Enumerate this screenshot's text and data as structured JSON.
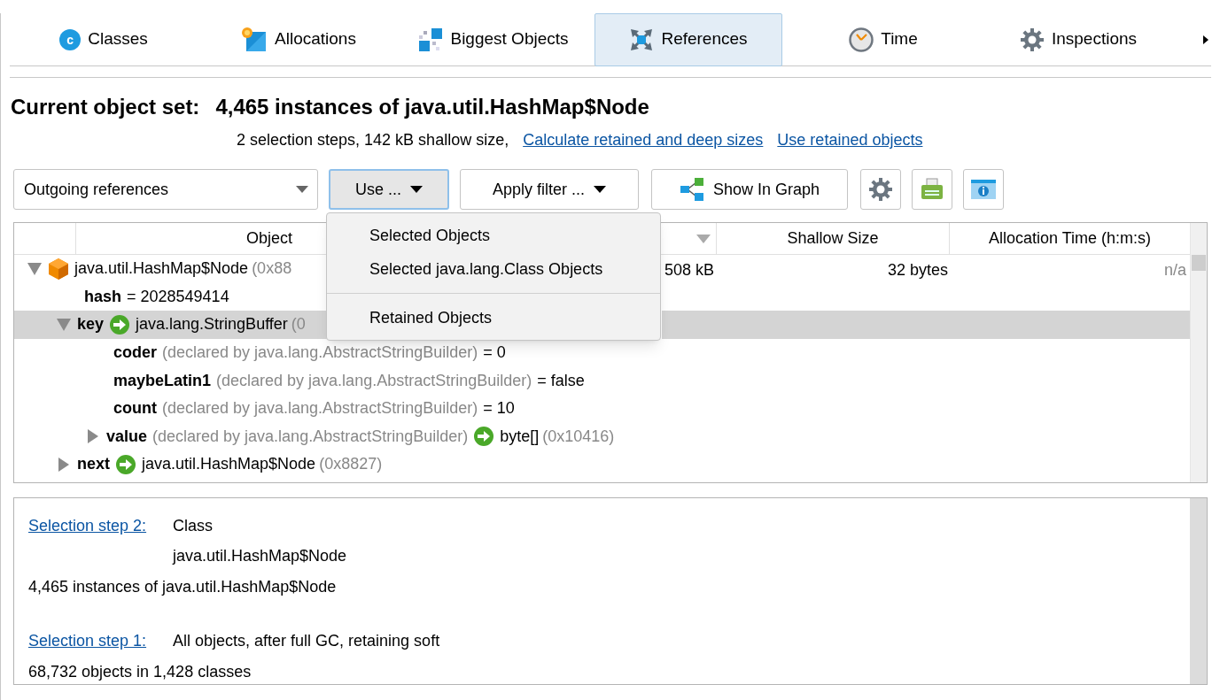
{
  "tabs": [
    {
      "label": "Classes",
      "badge": "c",
      "selected": false
    },
    {
      "label": "Allocations",
      "selected": false
    },
    {
      "label": "Biggest Objects",
      "selected": false
    },
    {
      "label": "References",
      "selected": true
    },
    {
      "label": "Time",
      "selected": false
    },
    {
      "label": "Inspections",
      "selected": false
    }
  ],
  "header": {
    "label": "Current object set:",
    "value": "4,465 instances of java.util.HashMap$Node",
    "summary": "2 selection steps, 142 kB shallow size,",
    "links": [
      "Calculate retained and deep sizes",
      "Use retained objects"
    ]
  },
  "toolbar": {
    "view_select": "Outgoing references",
    "use_button": {
      "label": "Use ...",
      "open": true
    },
    "filter_button": "Apply filter ...",
    "graph_button": "Show In Graph"
  },
  "use_menu": [
    {
      "kind": "item",
      "label": "Selected Objects"
    },
    {
      "kind": "item",
      "label": "Selected java.lang.Class Objects"
    },
    {
      "kind": "separator"
    },
    {
      "kind": "item",
      "label": "Retained Objects"
    }
  ],
  "table": {
    "columns": [
      "Object",
      "Shallow Size",
      "Allocation Time (h:m:s)"
    ],
    "tree": [
      {
        "kind": "object",
        "label": "java.util.HashMap$Node",
        "address": "(0x88",
        "retained": "508 kB",
        "shallow": "32 bytes",
        "alloc_time": "n/a",
        "expanded": true,
        "selected": false,
        "children": [
          {
            "kind": "field",
            "name": "hash",
            "value": "= 2028549414",
            "selected": false
          },
          {
            "kind": "reference",
            "name": "key",
            "target": "java.lang.StringBuffer",
            "address": "(0",
            "expanded": true,
            "selected": true,
            "children": [
              {
                "kind": "field",
                "name": "coder",
                "declared": "(declared by java.lang.AbstractStringBuilder)",
                "value": "= 0",
                "selected": false
              },
              {
                "kind": "field",
                "name": "maybeLatin1",
                "declared": "(declared by java.lang.AbstractStringBuilder)",
                "value": "= false",
                "selected": false
              },
              {
                "kind": "field",
                "name": "count",
                "declared": "(declared by java.lang.AbstractStringBuilder)",
                "value": "= 10",
                "selected": false
              },
              {
                "kind": "reference",
                "name": "value",
                "declared": "(declared by java.lang.AbstractStringBuilder)",
                "target": "byte[]",
                "address": "(0x10416)",
                "expanded": false,
                "selected": false
              }
            ]
          },
          {
            "kind": "reference",
            "name": "next",
            "target": "java.util.HashMap$Node",
            "address": "(0x8827)",
            "expanded": false,
            "selected": false
          }
        ]
      }
    ]
  },
  "steps": [
    {
      "link": "Selection step 2:",
      "lines": [
        "Class",
        "java.util.HashMap$Node"
      ],
      "result": "4,465 instances of java.util.HashMap$Node"
    },
    {
      "link": "Selection step 1:",
      "lines": [
        "All objects, after full GC, retaining soft"
      ],
      "result": "68,732 objects in 1,428 classes"
    }
  ]
}
